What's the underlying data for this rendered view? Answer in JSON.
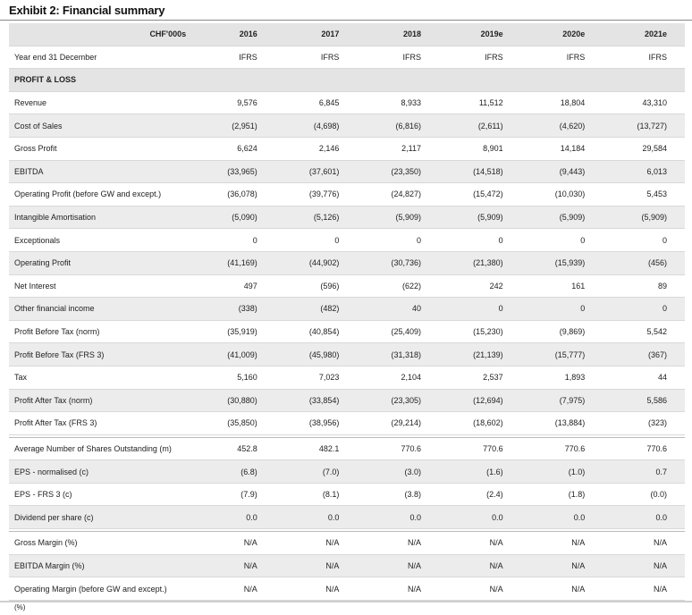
{
  "title": "Exhibit 2: Financial summary",
  "currency": "CHF'000s",
  "years": [
    "2016",
    "2017",
    "2018",
    "2019e",
    "2020e",
    "2021e"
  ],
  "year_end_label": "Year end 31 December",
  "standards": [
    "IFRS",
    "IFRS",
    "IFRS",
    "IFRS",
    "IFRS",
    "IFRS"
  ],
  "section_pl": "PROFIT & LOSS",
  "rows": [
    {
      "label": "Revenue",
      "values": [
        "9,576",
        "6,845",
        "8,933",
        "11,512",
        "18,804",
        "43,310"
      ]
    },
    {
      "label": "Cost of Sales",
      "values": [
        "(2,951)",
        "(4,698)",
        "(6,816)",
        "(2,611)",
        "(4,620)",
        "(13,727)"
      ]
    },
    {
      "label": "Gross Profit",
      "values": [
        "6,624",
        "2,146",
        "2,117",
        "8,901",
        "14,184",
        "29,584"
      ]
    },
    {
      "label": "EBITDA",
      "values": [
        "(33,965)",
        "(37,601)",
        "(23,350)",
        "(14,518)",
        "(9,443)",
        "6,013"
      ]
    },
    {
      "label": "Operating Profit (before GW and except.)",
      "values": [
        "(36,078)",
        "(39,776)",
        "(24,827)",
        "(15,472)",
        "(10,030)",
        "5,453"
      ]
    },
    {
      "label": "Intangible Amortisation",
      "values": [
        "(5,090)",
        "(5,126)",
        "(5,909)",
        "(5,909)",
        "(5,909)",
        "(5,909)"
      ]
    },
    {
      "label": "Exceptionals",
      "values": [
        "0",
        "0",
        "0",
        "0",
        "0",
        "0"
      ]
    },
    {
      "label": "Operating Profit",
      "values": [
        "(41,169)",
        "(44,902)",
        "(30,736)",
        "(21,380)",
        "(15,939)",
        "(456)"
      ]
    },
    {
      "label": "Net Interest",
      "values": [
        "497",
        "(596)",
        "(622)",
        "242",
        "161",
        "89"
      ]
    },
    {
      "label": "Other financial income",
      "values": [
        "(338)",
        "(482)",
        "40",
        "0",
        "0",
        "0"
      ]
    },
    {
      "label": "Profit Before Tax (norm)",
      "values": [
        "(35,919)",
        "(40,854)",
        "(25,409)",
        "(15,230)",
        "(9,869)",
        "5,542"
      ]
    },
    {
      "label": "Profit Before Tax (FRS 3)",
      "values": [
        "(41,009)",
        "(45,980)",
        "(31,318)",
        "(21,139)",
        "(15,777)",
        "(367)"
      ]
    },
    {
      "label": "Tax",
      "values": [
        "5,160",
        "7,023",
        "2,104",
        "2,537",
        "1,893",
        "44"
      ]
    },
    {
      "label": "Profit After Tax (norm)",
      "values": [
        "(30,880)",
        "(33,854)",
        "(23,305)",
        "(12,694)",
        "(7,975)",
        "5,586"
      ]
    },
    {
      "label": "Profit After Tax (FRS 3)",
      "values": [
        "(35,850)",
        "(38,956)",
        "(29,214)",
        "(18,602)",
        "(13,884)",
        "(323)"
      ]
    }
  ],
  "rows2": [
    {
      "label": "Average Number of Shares Outstanding (m)",
      "values": [
        "452.8",
        "482.1",
        "770.6",
        "770.6",
        "770.6",
        "770.6"
      ]
    },
    {
      "label": "EPS - normalised (c)",
      "values": [
        "(6.8)",
        "(7.0)",
        "(3.0)",
        "(1.6)",
        "(1.0)",
        "0.7"
      ]
    },
    {
      "label": "EPS - FRS 3 (c)",
      "values": [
        "(7.9)",
        "(8.1)",
        "(3.8)",
        "(2.4)",
        "(1.8)",
        "(0.0)"
      ]
    },
    {
      "label": "Dividend per share (c)",
      "values": [
        "0.0",
        "0.0",
        "0.0",
        "0.0",
        "0.0",
        "0.0"
      ]
    }
  ],
  "rows3": [
    {
      "label": "Gross Margin (%)",
      "values": [
        "N/A",
        "N/A",
        "N/A",
        "N/A",
        "N/A",
        "N/A"
      ]
    },
    {
      "label": "EBITDA Margin (%)",
      "values": [
        "N/A",
        "N/A",
        "N/A",
        "N/A",
        "N/A",
        "N/A"
      ]
    },
    {
      "label": "Operating Margin (before GW and except.)",
      "values": [
        "N/A",
        "N/A",
        "N/A",
        "N/A",
        "N/A",
        "N/A"
      ]
    }
  ],
  "last_label_cont": "(%)"
}
